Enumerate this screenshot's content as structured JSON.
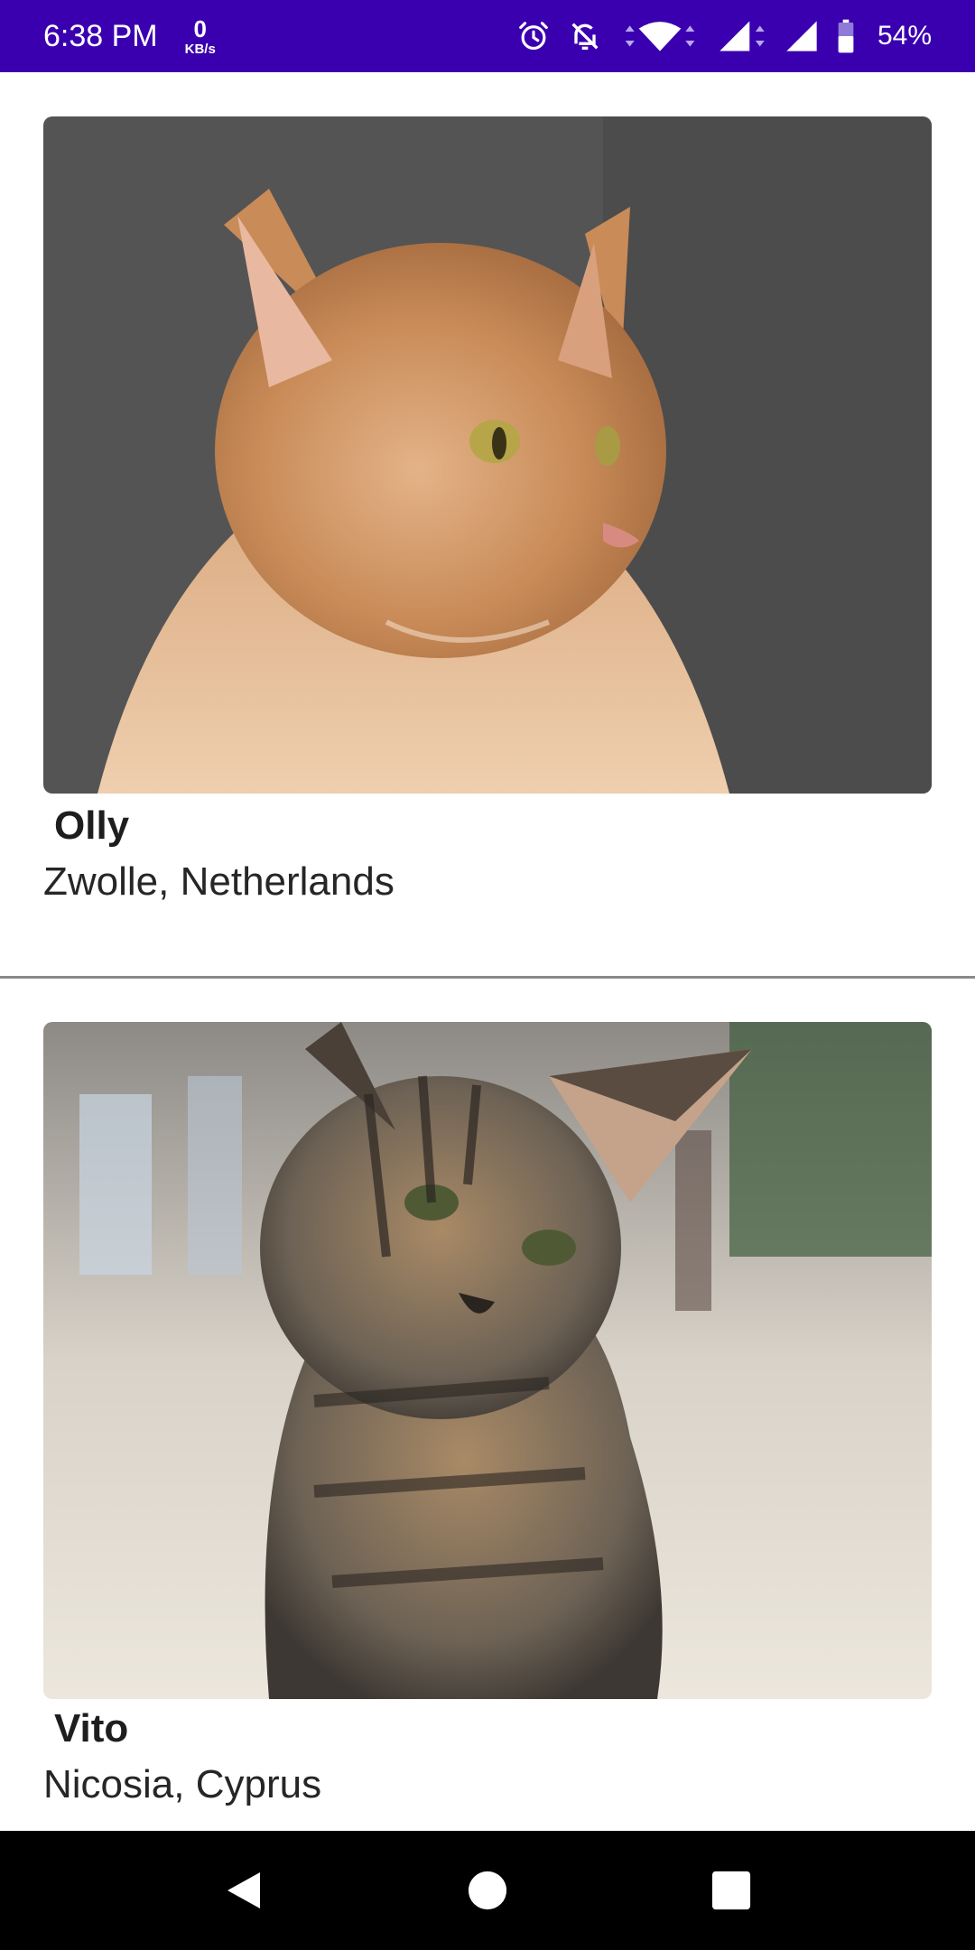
{
  "status_bar": {
    "time": "6:38 PM",
    "net_speed_value": "0",
    "net_speed_unit": "KB/s",
    "battery_percent": "54%",
    "icons": [
      "alarm-icon",
      "notifications-off-icon",
      "wifi-icon",
      "signal-icon",
      "signal-icon",
      "battery-icon"
    ],
    "background_color": "#3a00b0"
  },
  "cats": [
    {
      "name": "Olly",
      "location": "Zwolle, Netherlands",
      "photo": "orange-maine-coon-cat-photo"
    },
    {
      "name": "Vito",
      "location": "Nicosia, Cyprus",
      "photo": "tabby-kitten-photo"
    }
  ],
  "nav_bar": {
    "icons": [
      "back-icon",
      "home-icon",
      "recents-icon"
    ]
  }
}
